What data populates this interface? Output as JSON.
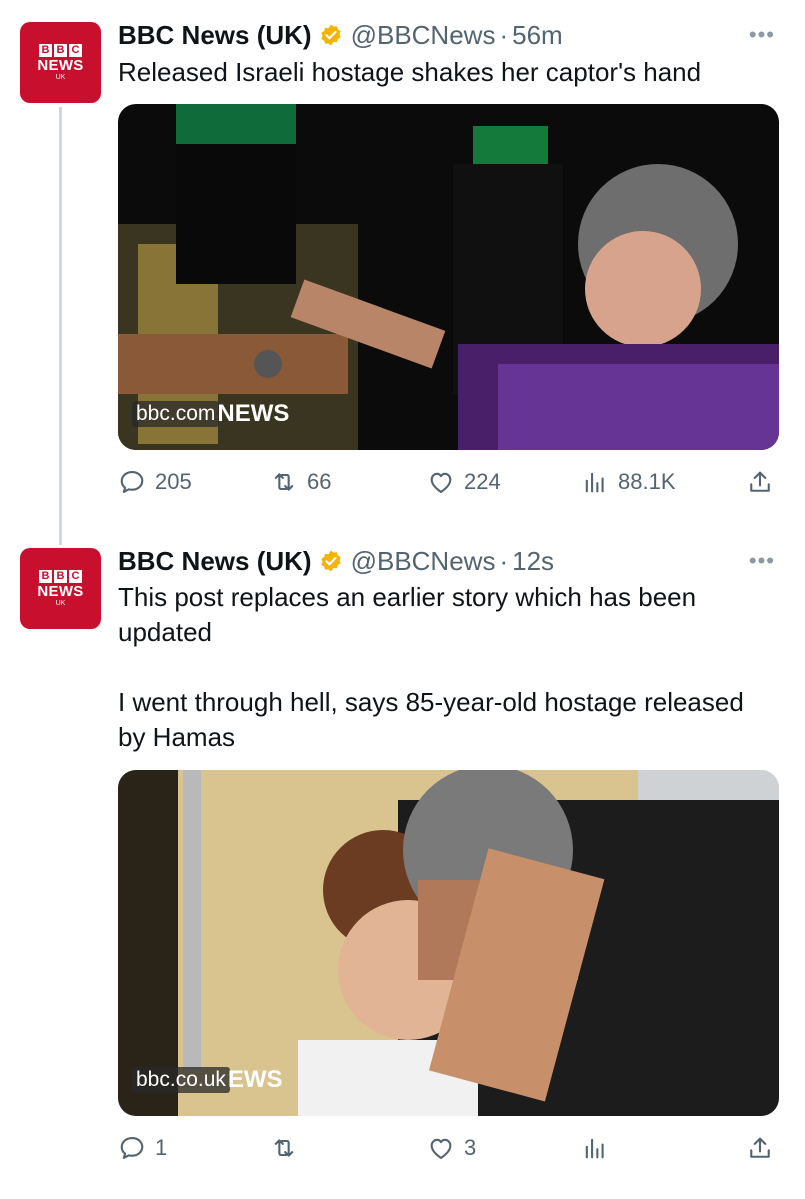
{
  "tweets": [
    {
      "avatar": {
        "letters": [
          "B",
          "B",
          "C"
        ],
        "word": "NEWS",
        "region": "UK"
      },
      "name": "BBC News (UK)",
      "handle": "@BBCNews",
      "time": "56m",
      "text": "Released Israeli hostage shakes her captor's hand",
      "media": {
        "watermark_url": "bbc.com",
        "watermark_brand": "NEWS"
      },
      "stats": {
        "replies": "205",
        "retweets": "66",
        "likes": "224",
        "views": "88.1K"
      }
    },
    {
      "avatar": {
        "letters": [
          "B",
          "B",
          "C"
        ],
        "word": "NEWS",
        "region": "UK"
      },
      "name": "BBC News (UK)",
      "handle": "@BBCNews",
      "time": "12s",
      "text": "This post replaces an earlier story which has been updated\n\nI went through hell, says 85-year-old hostage released by Hamas",
      "media": {
        "watermark_url": "bbc.co.uk",
        "watermark_brand": "EWS"
      },
      "stats": {
        "replies": "1",
        "retweets": "",
        "likes": "3",
        "views": ""
      }
    }
  ],
  "colors": {
    "verified": "#f4b400",
    "brand_red": "#c8102e",
    "secondary_text": "#536471"
  },
  "icons": [
    "reply-icon",
    "retweet-icon",
    "like-icon",
    "views-icon",
    "share-icon",
    "more-icon",
    "verified-badge-icon"
  ]
}
